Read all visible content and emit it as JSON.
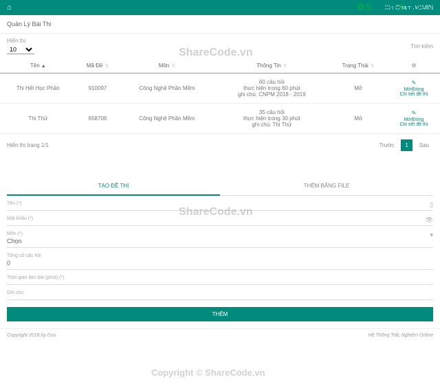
{
  "header": {
    "welcome": "Xin Chào: ADMIN"
  },
  "logo": {
    "text1": "S",
    "text2": "HARE",
    "text3": "C",
    "text4": "ODE",
    "text5": ".vn"
  },
  "panel": {
    "title": "Quản Lý Bài Thi"
  },
  "table": {
    "show_label": "Hiển thị",
    "show_value": "10",
    "search_label": "Tìm kiếm",
    "headers": {
      "ten": "Tên",
      "ma_de": "Mã Đề",
      "mon": "Môn",
      "thong_tin": "Thông Tin",
      "trang_thai": "Trạng Thái"
    },
    "rows": [
      {
        "ten": "Thi Hết Học Phần",
        "ma_de": "910097",
        "mon": "Công Nghệ Phần Mềm",
        "info1": "60 câu hỏi",
        "info2": "thực hiện trong 60 phút",
        "info3": "ghi chú: CNPM 2018 - 2019",
        "trang_thai": "Mở",
        "action1": "Mở/Đóng",
        "action2": "Chi tiết đề thi"
      },
      {
        "ten": "Thi Thử",
        "ma_de": "658706",
        "mon": "Công Nghệ Phần Mềm",
        "info1": "35 câu hỏi",
        "info2": "thực hiện trong 30 phút",
        "info3": "ghi chú: Thi Thử",
        "trang_thai": "Mở",
        "action1": "Mở/Đóng",
        "action2": "Chi tiết đề thi"
      }
    ],
    "footer_info": "Hiển thị trang 1/1",
    "prev": "Trước",
    "page": "1",
    "next": "Sau"
  },
  "tabs": {
    "tab1": "TẠO ĐỀ THI",
    "tab2": "THÊM BẰNG FILE"
  },
  "form": {
    "ten_label": "Tên (*)",
    "matkhau_label": "Mật khẩu (*)",
    "mon_label": "Môn (*)",
    "mon_value": "Chọn",
    "tongso_label": "Tổng số câu hỏi",
    "tongso_value": "0",
    "thoigian_label": "Thời gian làm bài (phút) (*)",
    "ghichu_label": "Ghi chú",
    "submit": "THÊM"
  },
  "footer": {
    "left": "Copyright 2018 by Dzu",
    "right": "Hệ Thống Trắc Nghiệm Online"
  },
  "watermark": {
    "wm": "ShareCode.vn",
    "copyright": "Copyright © ShareCode.vn"
  }
}
